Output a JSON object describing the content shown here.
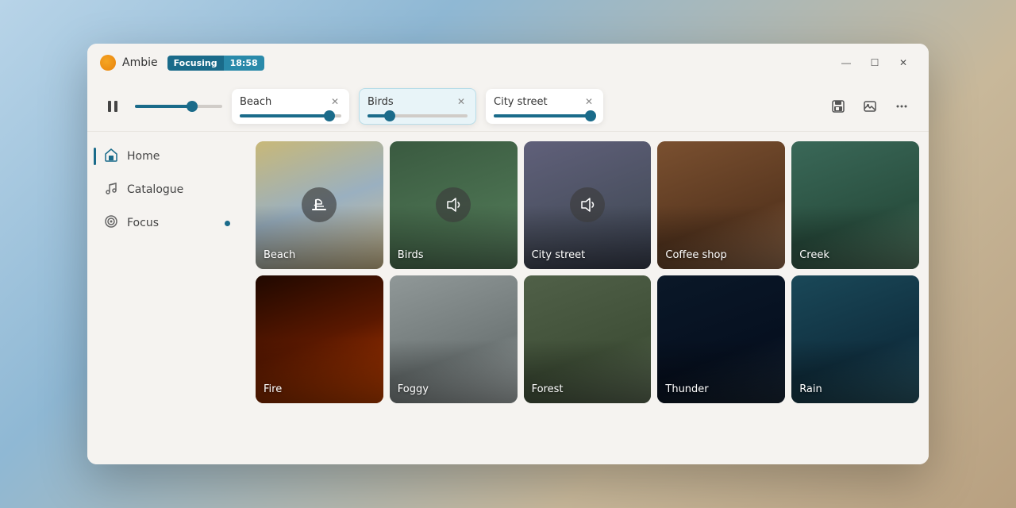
{
  "app": {
    "name": "Ambie",
    "focus_label": "Focusing",
    "focus_time": "18:58"
  },
  "window_controls": {
    "minimize": "—",
    "maximize": "☐",
    "close": "✕"
  },
  "toolbar": {
    "master_slider_value": 65,
    "chips": [
      {
        "id": "beach",
        "name": "Beach",
        "value": 88
      },
      {
        "id": "birds",
        "name": "Birds",
        "value": 22
      },
      {
        "id": "citystreet",
        "name": "City street",
        "value": 95
      }
    ],
    "save_label": "Save",
    "image_label": "Image",
    "more_label": "More"
  },
  "sidebar": {
    "items": [
      {
        "id": "home",
        "label": "Home",
        "icon": "🏠",
        "active": true
      },
      {
        "id": "catalogue",
        "label": "Catalogue",
        "icon": "🎵",
        "active": false
      },
      {
        "id": "focus",
        "label": "Focus",
        "icon": "🎯",
        "active": false,
        "dot": true
      }
    ]
  },
  "grid": {
    "sounds": [
      {
        "id": "beach",
        "label": "Beach",
        "theme": "card-beach",
        "active": true
      },
      {
        "id": "birds",
        "label": "Birds",
        "theme": "card-birds",
        "active": true
      },
      {
        "id": "citystreet",
        "label": "City street",
        "theme": "card-citystreet",
        "active": true
      },
      {
        "id": "coffeeshop",
        "label": "Coffee shop",
        "theme": "card-coffeeshop",
        "active": false
      },
      {
        "id": "creek",
        "label": "Creek",
        "theme": "card-creek",
        "active": false
      },
      {
        "id": "fire",
        "label": "Fire",
        "theme": "card-fire",
        "active": false
      },
      {
        "id": "foggy",
        "label": "Foggy",
        "theme": "card-foggy",
        "active": false
      },
      {
        "id": "forest",
        "label": "Forest",
        "theme": "card-forest",
        "active": false
      },
      {
        "id": "thunder",
        "label": "Thunder",
        "theme": "card-thunder",
        "active": false
      },
      {
        "id": "rain",
        "label": "Rain",
        "theme": "card-rain",
        "active": false
      }
    ]
  }
}
